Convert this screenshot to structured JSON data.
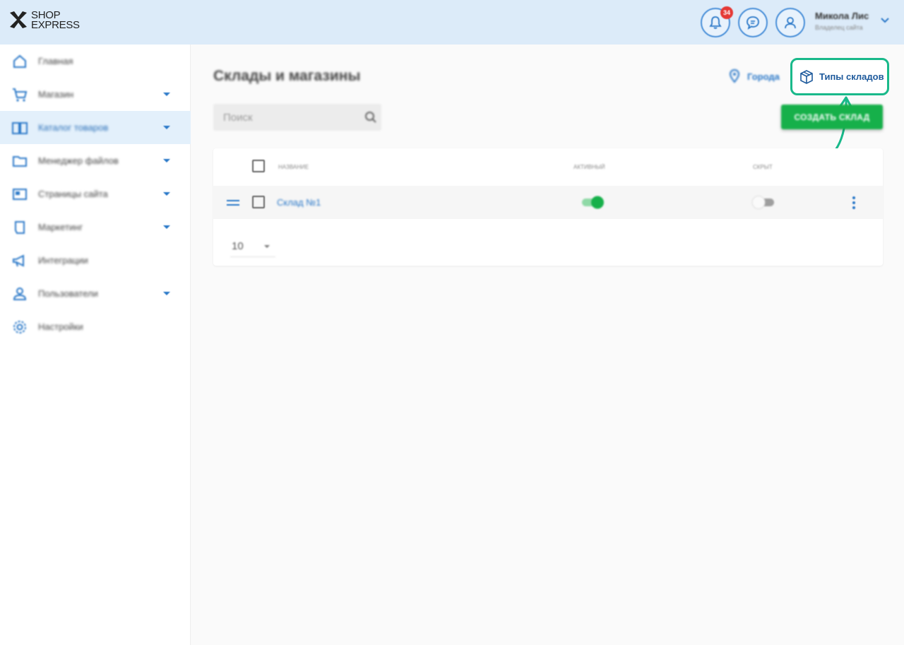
{
  "header": {
    "logo_line1": "SHOP",
    "logo_line2": "EXPRESS",
    "notification_count": "34",
    "user_name": "Микола Лис",
    "user_role": "Владелец сайта"
  },
  "sidebar": {
    "items": [
      {
        "label": "Главная",
        "icon": "home-icon",
        "has_caret": false,
        "active": false
      },
      {
        "label": "Магазин",
        "icon": "cart-icon",
        "has_caret": true,
        "active": false
      },
      {
        "label": "Каталог товаров",
        "icon": "book-icon",
        "has_caret": true,
        "active": true
      },
      {
        "label": "Менеджер файлов",
        "icon": "folder-icon",
        "has_caret": true,
        "active": false
      },
      {
        "label": "Страницы сайта",
        "icon": "page-icon",
        "has_caret": true,
        "active": false
      },
      {
        "label": "Маркетинг",
        "icon": "marketing-icon",
        "has_caret": true,
        "active": false
      },
      {
        "label": "Интеграции",
        "icon": "megaphone-icon",
        "has_caret": false,
        "active": false
      },
      {
        "label": "Пользователи",
        "icon": "users-icon",
        "has_caret": true,
        "active": false
      },
      {
        "label": "Настройки",
        "icon": "gear-icon",
        "has_caret": false,
        "active": false
      }
    ]
  },
  "main": {
    "title": "Склады и магазины",
    "cities_label": "Города",
    "warehouse_types_label": "Типы складов",
    "search_placeholder": "Поиск",
    "create_button": "СОЗДАТЬ СКЛАД",
    "table": {
      "headers": {
        "name": "Название",
        "active": "Активный",
        "hidden": "Скрыт"
      },
      "rows": [
        {
          "name": "Склад №1",
          "active": true,
          "hidden": false
        }
      ],
      "page_size": "10"
    }
  },
  "colors": {
    "accent": "#2a78c8",
    "highlight": "#19b98a",
    "create_button": "#16b04a",
    "header_bg": "#dcebf9"
  }
}
